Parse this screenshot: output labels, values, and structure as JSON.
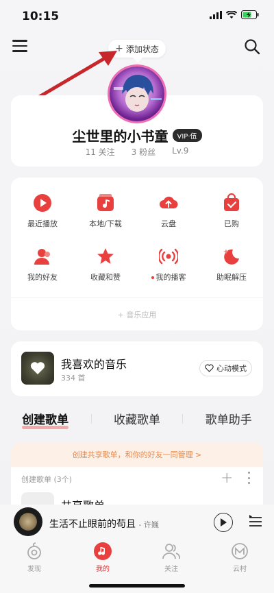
{
  "status_bar": {
    "time": "10:15"
  },
  "top_bar": {
    "add_status_label": "添加状态"
  },
  "profile": {
    "username": "尘世里的小书童",
    "vip_badge": "VIP·伍",
    "following": "11 关注",
    "followers": "3 粉丝",
    "level": "Lv.9"
  },
  "apps": [
    {
      "label": "最近播放",
      "icon": "play-circle-icon"
    },
    {
      "label": "本地/下载",
      "icon": "music-note-icon"
    },
    {
      "label": "云盘",
      "icon": "cloud-upload-icon"
    },
    {
      "label": "已购",
      "icon": "shopping-bag-icon"
    },
    {
      "label": "我的好友",
      "icon": "friends-icon"
    },
    {
      "label": "收藏和赞",
      "icon": "star-icon"
    },
    {
      "label": "我的播客",
      "icon": "broadcast-icon",
      "dot": true
    },
    {
      "label": "助眠解压",
      "icon": "moon-icon"
    }
  ],
  "music_apps_label": "+ 音乐应用",
  "liked": {
    "title": "我喜欢的音乐",
    "count": "334 首",
    "heart_mode_label": "心动模式"
  },
  "tabs": [
    {
      "label": "创建歌单",
      "active": true
    },
    {
      "label": "收藏歌单",
      "active": false
    },
    {
      "label": "歌单助手",
      "active": false
    }
  ],
  "shared_banner": "创建共享歌单，和你的好友一同管理 >",
  "created_header": "创建歌单 (3个)",
  "playlists": [
    {
      "name": "共享歌单"
    }
  ],
  "player": {
    "song": "生活不止眼前的苟且",
    "artist": "- 许巍"
  },
  "nav": [
    {
      "label": "发现",
      "icon": "discover-icon",
      "active": false
    },
    {
      "label": "我的",
      "icon": "my-music-icon",
      "active": true
    },
    {
      "label": "关注",
      "icon": "follow-icon",
      "active": false
    },
    {
      "label": "云村",
      "icon": "cloud-village-icon",
      "active": false
    }
  ],
  "colors": {
    "accent": "#e8403e",
    "banner_text": "#e58a4e",
    "banner_bg": "#fdf0e7"
  }
}
